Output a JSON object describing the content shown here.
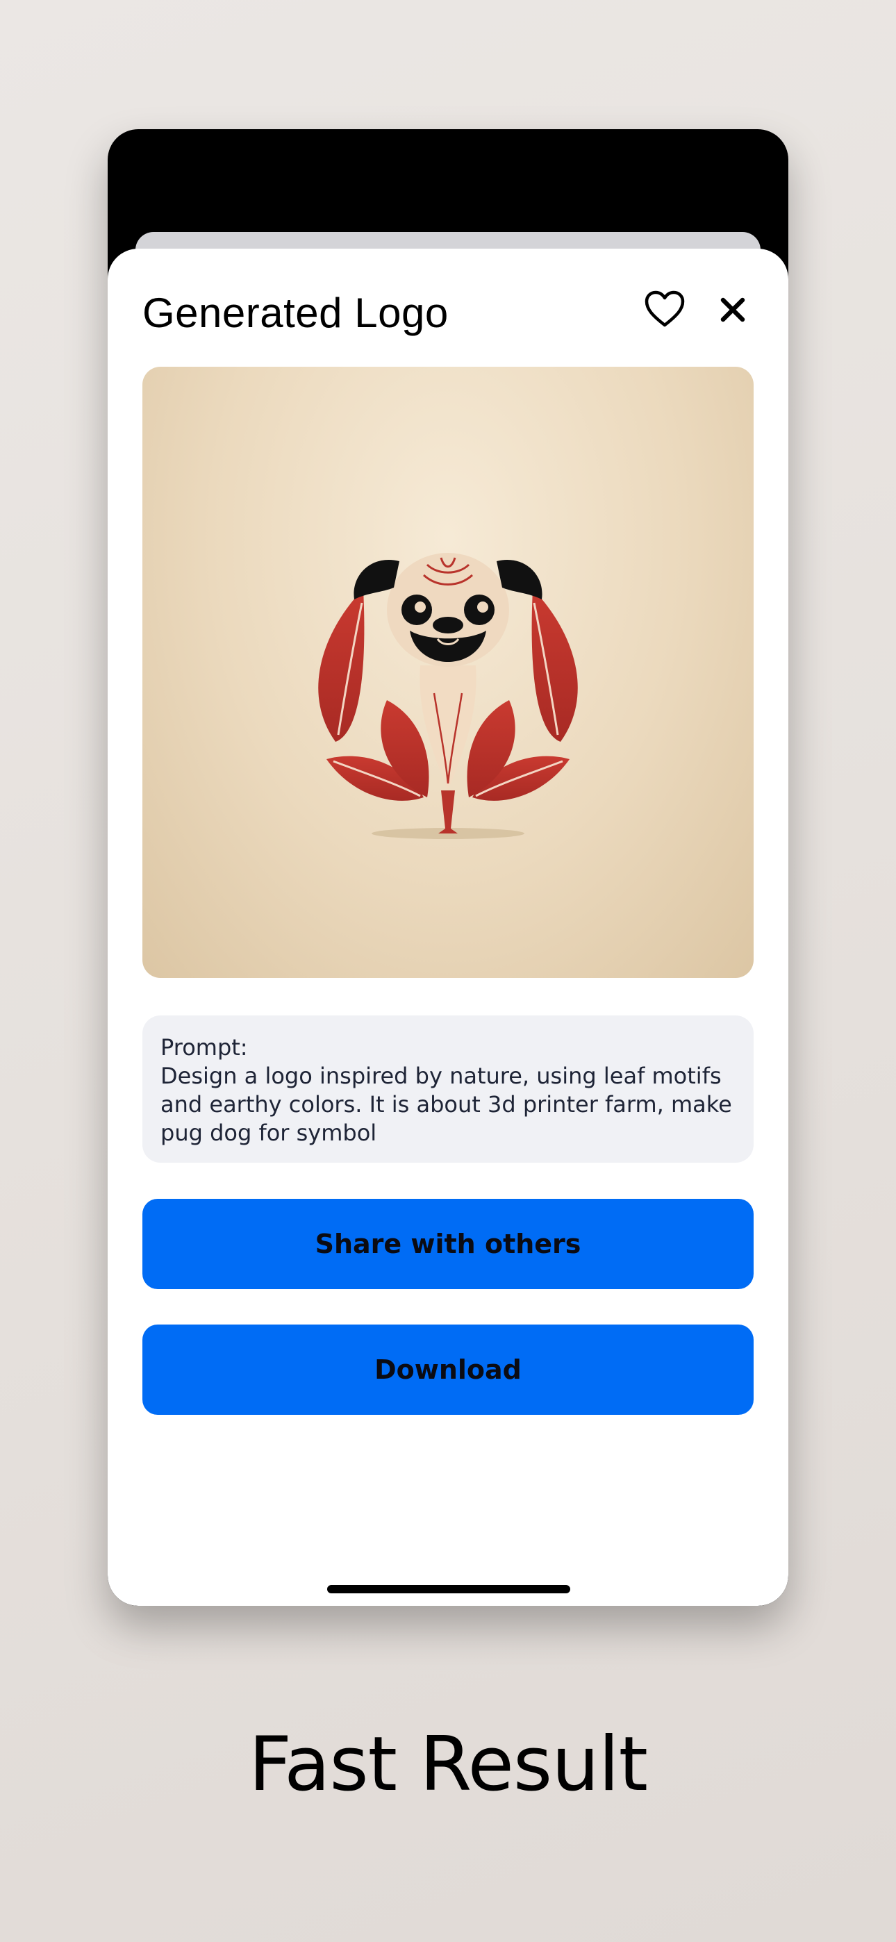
{
  "modal": {
    "title": "Generated Logo",
    "favorite_icon": "heart-outline-icon",
    "close_icon": "close-x-icon"
  },
  "image": {
    "subject": "pug-with-leaves-logo"
  },
  "prompt": {
    "label": "Prompt:",
    "text": "Design a logo inspired by nature, using leaf motifs and earthy colors. It is about 3d printer farm, make pug dog for symbol"
  },
  "actions": {
    "share_label": "Share with others",
    "download_label": "Download"
  },
  "caption": "Fast Result",
  "colors": {
    "accent_button": "#006cf5",
    "leaf_red": "#b8332b",
    "image_bg": "#ebd9bd",
    "prompt_bg": "#f0f1f5"
  }
}
